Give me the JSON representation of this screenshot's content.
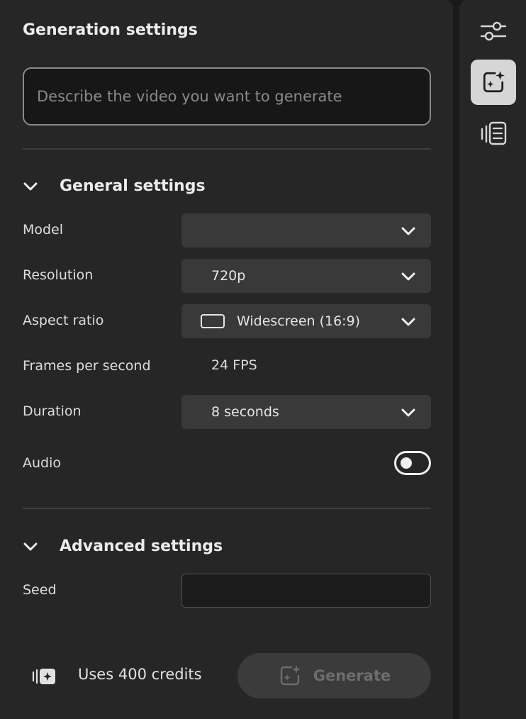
{
  "panel": {
    "title": "Generation settings",
    "prompt": {
      "placeholder": "Describe the video you want to generate",
      "value": ""
    }
  },
  "general": {
    "heading": "General settings",
    "model": {
      "label": "Model",
      "value": ""
    },
    "resolution": {
      "label": "Resolution",
      "value": "720p"
    },
    "aspect_ratio": {
      "label": "Aspect ratio",
      "value": "Widescreen (16:9)",
      "icon": "widescreen-rectangle-icon"
    },
    "fps": {
      "label": "Frames per second",
      "value": "24 FPS"
    },
    "duration": {
      "label": "Duration",
      "value": "8 seconds"
    },
    "audio": {
      "label": "Audio",
      "enabled": false
    }
  },
  "advanced": {
    "heading": "Advanced settings",
    "seed": {
      "label": "Seed",
      "value": ""
    }
  },
  "footer": {
    "credits_text": "Uses 400 credits",
    "generate_label": "Generate",
    "generate_enabled": false
  },
  "rail": {
    "items": [
      {
        "icon": "sliders-icon",
        "active": false
      },
      {
        "icon": "sparkle-generate-icon",
        "active": true
      },
      {
        "icon": "history-list-icon",
        "active": false
      }
    ]
  },
  "colors": {
    "panel_bg": "#262626",
    "control_bg": "#393939",
    "rail_active_bg": "#d6d6d6",
    "text": "#e8e8e8",
    "disabled_text": "#6d6d6d"
  }
}
